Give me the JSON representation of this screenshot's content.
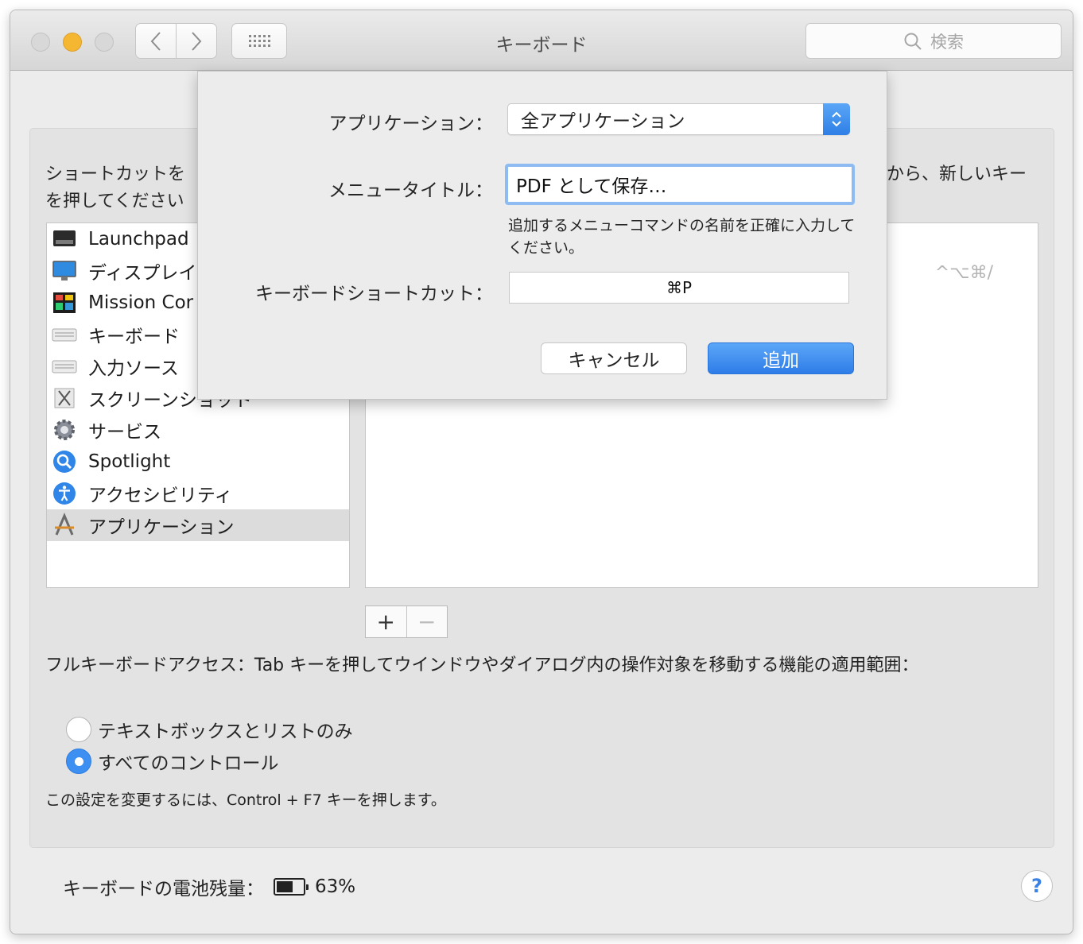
{
  "window": {
    "title": "キーボード",
    "search_placeholder": "検索"
  },
  "panel": {
    "instruction": "ショートカットを\nを押してください",
    "instruction_right": "から、新しいキー",
    "categories": [
      {
        "label": "Launchpad",
        "icon": "launchpad-icon"
      },
      {
        "label": "ディスプレイ",
        "icon": "display-icon"
      },
      {
        "label": "Mission Cor",
        "icon": "mission-control-icon"
      },
      {
        "label": "キーボード",
        "icon": "keyboard-icon"
      },
      {
        "label": "入力ソース",
        "icon": "input-source-icon"
      },
      {
        "label": "スクリーンショット",
        "icon": "screenshot-icon"
      },
      {
        "label": "サービス",
        "icon": "gear-icon"
      },
      {
        "label": "Spotlight",
        "icon": "spotlight-icon"
      },
      {
        "label": "アクセシビリティ",
        "icon": "accessibility-icon"
      },
      {
        "label": "アプリケーション",
        "icon": "app-store-icon",
        "selected": true
      }
    ],
    "detail_shortcut": "^⌥⌘/",
    "add_label": "+",
    "remove_label": "−",
    "full_keyboard_access": "フルキーボードアクセス：Tab キーを押してウインドウやダイアログ内の操作対象を移動する機能の適用範囲：",
    "radio_options": [
      {
        "label": "テキストボックスとリストのみ",
        "checked": false
      },
      {
        "label": "すべてのコントロール",
        "checked": true
      }
    ],
    "hint": "この設定を変更するには、Control + F7 キーを押します。"
  },
  "footer": {
    "battery_label": "キーボードの電池残量：",
    "battery_percent": "63%",
    "battery_level": 0.63,
    "help_label": "?"
  },
  "sheet": {
    "application_label": "アプリケーション：",
    "application_value": "全アプリケーション",
    "menu_title_label": "メニュータイトル：",
    "menu_title_value": "PDF として保存…",
    "menu_title_hint": "追加するメニューコマンドの名前を正確に入力してください。",
    "shortcut_label": "キーボードショートカット：",
    "shortcut_value": "⌘P",
    "cancel_label": "キャンセル",
    "add_label": "追加"
  },
  "colors": {
    "accent": "#2e7ce8",
    "focus_ring": "#8ebcf2",
    "minimize": "#f5b731"
  }
}
